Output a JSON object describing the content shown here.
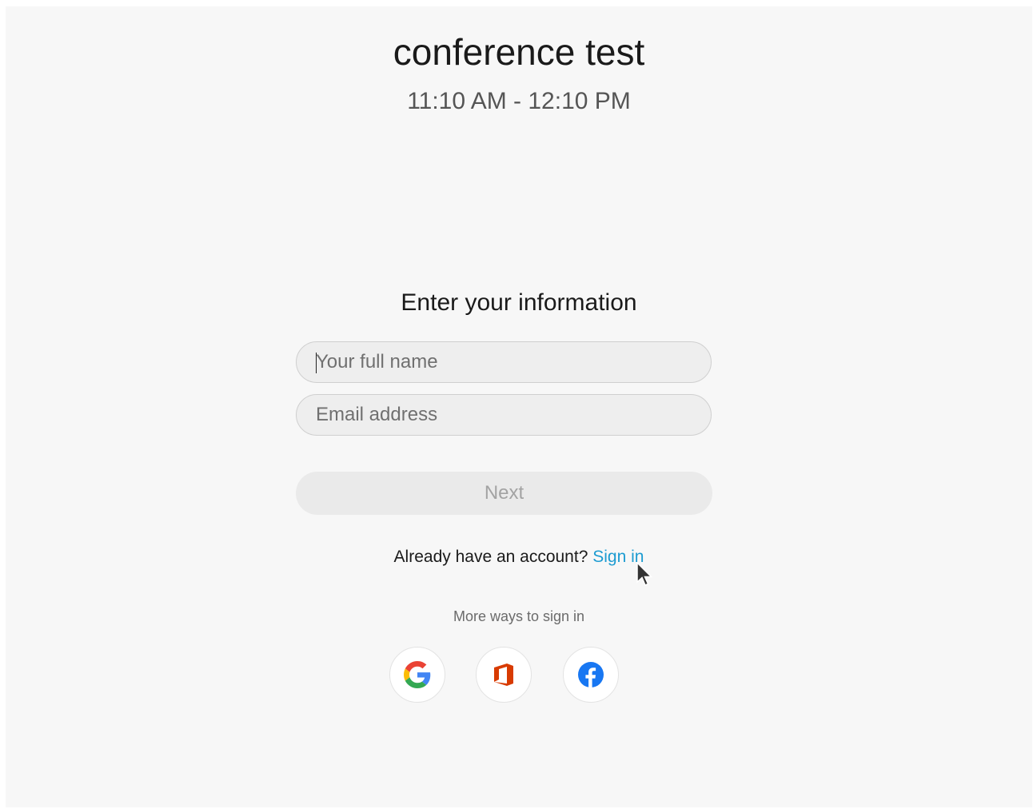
{
  "meeting": {
    "title": "conference test",
    "time_range": "11:10 AM - 12:10 PM"
  },
  "form": {
    "heading": "Enter your information",
    "full_name_placeholder": "Your full name",
    "full_name_value": "",
    "email_placeholder": "Email address",
    "email_value": "",
    "next_label": "Next",
    "next_enabled": false
  },
  "account": {
    "prompt": "Already have an account?",
    "signin_label": "Sign in"
  },
  "alt_signin": {
    "label": "More ways to sign in",
    "providers": [
      {
        "name": "Google",
        "icon": "google-icon"
      },
      {
        "name": "Office",
        "icon": "office-icon"
      },
      {
        "name": "Facebook",
        "icon": "facebook-icon"
      }
    ]
  },
  "colors": {
    "link": "#1c9bd1",
    "background": "#f7f7f7",
    "office_orange": "#d83b01",
    "facebook_blue": "#1877f2"
  }
}
